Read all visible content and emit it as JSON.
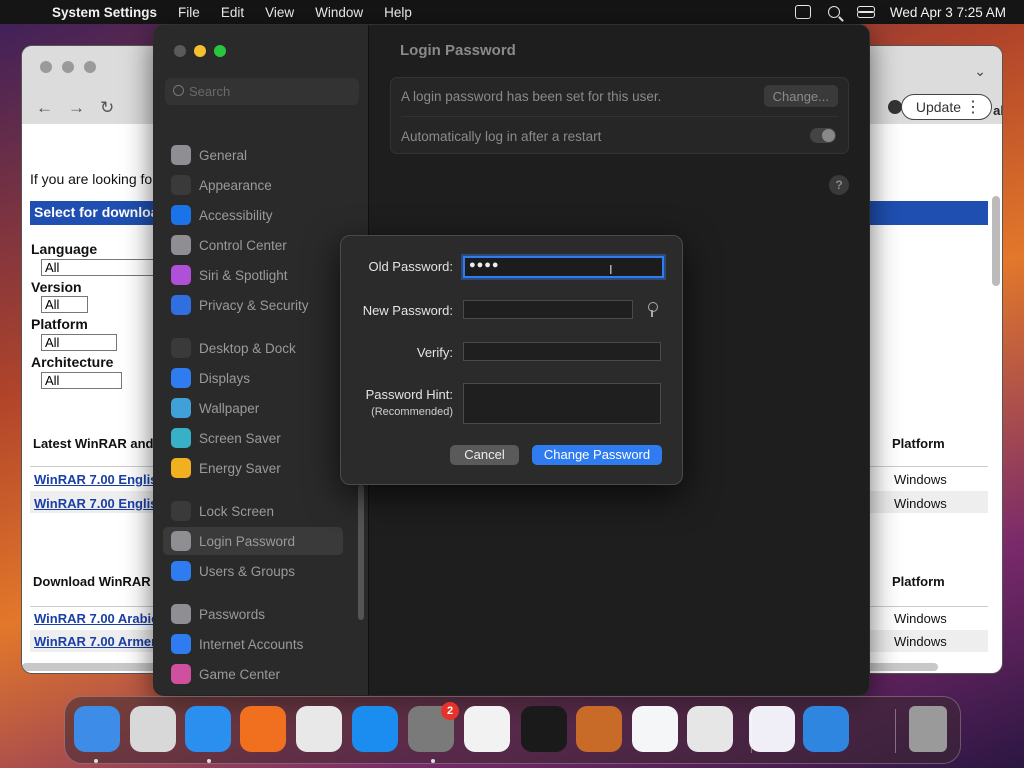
{
  "menubar": {
    "app_name": "System Settings",
    "items": [
      "File",
      "Edit",
      "View",
      "Window",
      "Help"
    ],
    "clock": "Wed Apr 3  7:25 AM"
  },
  "browser": {
    "update_label": "Update",
    "partial_right_text": "al",
    "intro_text": "If you are looking fo",
    "blue_bar_text": "Select for downloa",
    "language_label": "Language",
    "language_value": "All",
    "version_label": "Version",
    "version_value": "All",
    "platform_label": "Platform",
    "platform_value": "All",
    "arch_label": "Architecture",
    "arch_value": "All",
    "latest_heading": "Latest WinRAR and",
    "download_heading": "Download WinRAR",
    "platform_col": "Platform",
    "links": [
      "WinRAR 7.00 Englis",
      "WinRAR 7.00 Englis",
      "WinRAR 7.00 Arabic",
      "WinRAR 7.00 Armen"
    ],
    "platform_values": [
      "Windows",
      "Windows",
      "Windows",
      "Windows"
    ]
  },
  "settings": {
    "search_placeholder": "Search",
    "page_title": "Login Password",
    "password_status": "A login password has been set for this user.",
    "change_label": "Change...",
    "auto_login_label": "Automatically log in after a restart",
    "help_label": "?",
    "sidebar": [
      {
        "label": "General",
        "icon": "gear-icon",
        "color": "#8e8e93"
      },
      {
        "label": "Appearance",
        "icon": "appearance-icon",
        "color": "#3a3a3a"
      },
      {
        "label": "Accessibility",
        "icon": "accessibility-icon",
        "color": "#1a73e8"
      },
      {
        "label": "Control Center",
        "icon": "control-center-icon",
        "color": "#8e8e93"
      },
      {
        "label": "Siri & Spotlight",
        "icon": "siri-icon",
        "color": "#b04fd8"
      },
      {
        "label": "Privacy & Security",
        "icon": "hand-icon",
        "color": "#2f6fe0"
      },
      {
        "label": "Desktop & Dock",
        "icon": "dock-icon",
        "color": "#3a3a3a"
      },
      {
        "label": "Displays",
        "icon": "displays-icon",
        "color": "#2f7bf0"
      },
      {
        "label": "Wallpaper",
        "icon": "wallpaper-icon",
        "color": "#40a0d8"
      },
      {
        "label": "Screen Saver",
        "icon": "screen-saver-icon",
        "color": "#38b0c8"
      },
      {
        "label": "Energy Saver",
        "icon": "energy-icon",
        "color": "#f0b020"
      },
      {
        "label": "Lock Screen",
        "icon": "lock-icon",
        "color": "#3a3a3a"
      },
      {
        "label": "Login Password",
        "icon": "login-password-icon",
        "color": "#8e8e93"
      },
      {
        "label": "Users & Groups",
        "icon": "users-icon",
        "color": "#2f7bf0"
      },
      {
        "label": "Passwords",
        "icon": "key-icon",
        "color": "#8e8e93"
      },
      {
        "label": "Internet Accounts",
        "icon": "at-icon",
        "color": "#2f7bf0"
      },
      {
        "label": "Game Center",
        "icon": "game-center-icon",
        "color": "#d050a0"
      }
    ]
  },
  "dialog": {
    "old_label": "Old Password:",
    "old_value": "●●●●",
    "new_label": "New Password:",
    "verify_label": "Verify:",
    "hint_label": "Password Hint:",
    "hint_sub": "(Recommended)",
    "cancel_label": "Cancel",
    "submit_label": "Change Password"
  },
  "dock": {
    "badge_count": "2",
    "apps": [
      {
        "name": "finder-icon",
        "color": "#3d8de8"
      },
      {
        "name": "launchpad-icon",
        "color": "#d8d8d8"
      },
      {
        "name": "safari-icon",
        "color": "#2b8ff0"
      },
      {
        "name": "firefox-icon",
        "color": "#f07020"
      },
      {
        "name": "chrome-icon",
        "color": "#e8e8e8"
      },
      {
        "name": "app-store-icon",
        "color": "#1b8cf0"
      },
      {
        "name": "system-settings-icon",
        "color": "#7a7a7a"
      },
      {
        "name": "textedit-icon",
        "color": "#f2f2f2"
      },
      {
        "name": "terminal-icon",
        "color": "#1a1a1a"
      },
      {
        "name": "garageband-icon",
        "color": "#c86a28"
      },
      {
        "name": "vscode-icon",
        "color": "#f4f6f8"
      },
      {
        "name": "roblox-icon",
        "color": "#e6e6e6"
      },
      {
        "name": "visual-studio-icon",
        "color": "#f0eef6"
      },
      {
        "name": "weather-icon",
        "color": "#2f86e0"
      },
      {
        "name": "trash-icon",
        "color": "#9a9a9a"
      }
    ]
  }
}
